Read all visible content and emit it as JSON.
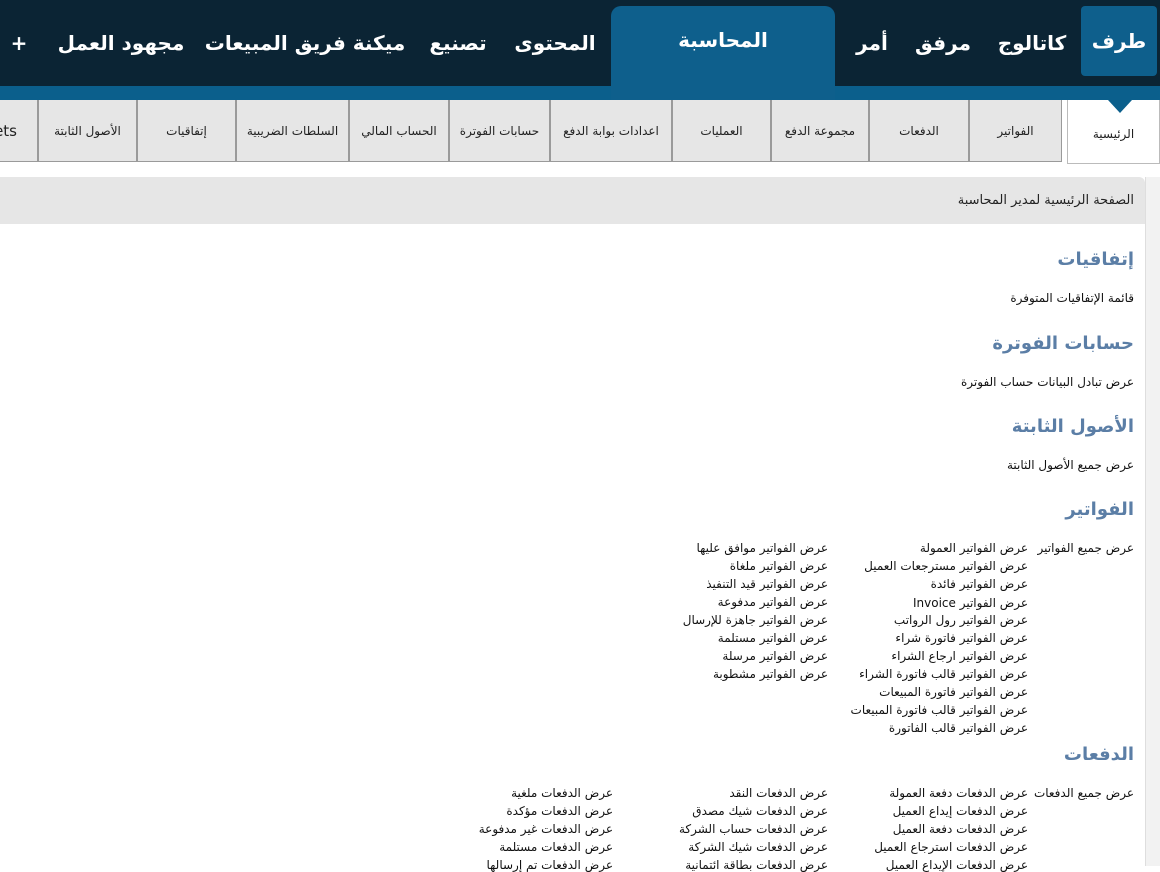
{
  "top_nav": {
    "items": [
      "طرف",
      "كاتالوج",
      "مرفق",
      "أمر",
      "المحاسبة",
      "المحتوى",
      "تصنيع",
      "ميكنة فريق المبيعات",
      "مجهود العمل",
      "+"
    ],
    "active": "المحاسبة"
  },
  "tabs": {
    "items": [
      "الرئيسية",
      "الفواتير",
      "الدفعات",
      "مجموعة الدفع",
      "العمليات",
      "اعدادات بوابة الدفع",
      "حسابات الفوترة",
      "الحساب المالي",
      "السلطات الضريبية",
      "إتفاقيات",
      "الأصول الثابتة",
      "ets"
    ],
    "active": "الرئيسية"
  },
  "page": {
    "title": "الصفحة الرئيسية لمدير المحاسبة"
  },
  "sections": {
    "agreements": {
      "heading": "إتفاقيات",
      "links": [
        "قائمة الإتفاقيات المتوفرة"
      ]
    },
    "billing": {
      "heading": "حسابات الفوترة",
      "links": [
        "عرض تبادل البيانات حساب الفوترة"
      ]
    },
    "fixed_assets": {
      "heading": "الأصول الثابتة",
      "links": [
        "عرض جميع الأصول الثابتة"
      ]
    },
    "invoices": {
      "heading": "الفواتير",
      "col1_first": "عرض جميع الفواتير",
      "col1": [
        "عرض الفواتير العمولة",
        "عرض الفواتير مسترجعات العميل",
        "عرض الفواتير فائدة",
        "عرض الفواتير Invoice",
        "عرض الفواتير رول الرواتب",
        "عرض الفواتير فاتورة شراء",
        "عرض الفواتير ارجاع الشراء",
        "عرض الفواتير قالب فاتورة الشراء",
        "عرض الفواتير فاتورة المبيعات",
        "عرض الفواتير قالب فاتورة المبيعات",
        "عرض الفواتير قالب الفاتورة"
      ],
      "col2": [
        "عرض الفواتير موافق عليها",
        "عرض الفواتير ملغاة",
        "عرض الفواتير قيد التنفيذ",
        "عرض الفواتير مدفوعة",
        "عرض الفواتير جاهزة للإرسال",
        "عرض الفواتير مستلمة",
        "عرض الفواتير مرسلة",
        "عرض الفواتير مشطوبة"
      ]
    },
    "payments": {
      "heading": "الدفعات",
      "col1_first": "عرض جميع الدفعات",
      "col1": [
        "عرض الدفعات دفعة العمولة",
        "عرض الدفعات إيداع العميل",
        "عرض الدفعات دفعة العميل",
        "عرض الدفعات استرجاع العميل",
        "عرض الدفعات الإيداع العميل"
      ],
      "col2": [
        "عرض الدفعات النقد",
        "عرض الدفعات شيك مصدق",
        "عرض الدفعات حساب الشركة",
        "عرض الدفعات شيك الشركة",
        "عرض الدفعات بطاقة ائتمانية"
      ],
      "col3": [
        "عرض الدفعات ملغية",
        "عرض الدفعات مؤكدة",
        "عرض الدفعات غير مدفوعة",
        "عرض الدفعات مستلمة",
        "عرض الدفعات تم إرسالها"
      ]
    }
  },
  "colors": {
    "topbar_bg": "#0b2434",
    "accent": "#0e5f8c",
    "heading": "#5b7ea6",
    "tab_bg": "#e6e6e6"
  }
}
